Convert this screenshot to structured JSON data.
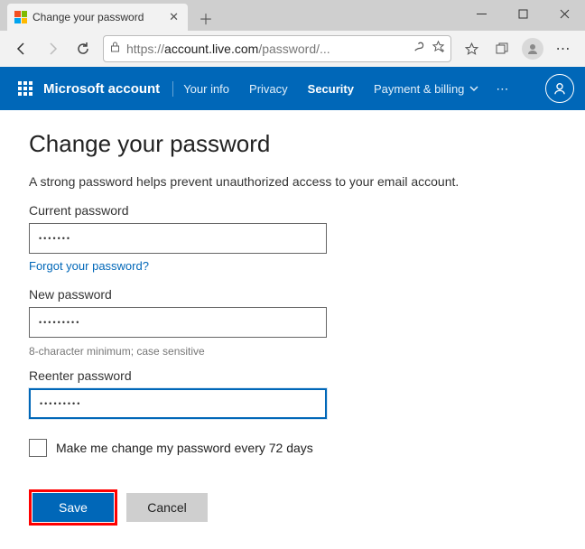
{
  "window": {
    "tab_title": "Change your password",
    "url_prefix": "https://",
    "url_host": "account.live.com",
    "url_path": "/password/..."
  },
  "nav": {
    "brand": "Microsoft account",
    "items": [
      {
        "label": "Your info"
      },
      {
        "label": "Privacy"
      },
      {
        "label": "Security",
        "active": true
      },
      {
        "label": "Payment & billing",
        "dropdown": true
      }
    ]
  },
  "page": {
    "title": "Change your password",
    "subtitle": "A strong password helps prevent unauthorized access to your email account.",
    "current_label": "Current password",
    "current_value": "•••••••",
    "forgot_link": "Forgot your password?",
    "new_label": "New password",
    "new_value": "•••••••••",
    "hint": "8-character minimum; case sensitive",
    "reenter_label": "Reenter password",
    "reenter_value": "•••••••••",
    "checkbox_label": "Make me change my password every 72 days",
    "save_btn": "Save",
    "cancel_btn": "Cancel"
  }
}
